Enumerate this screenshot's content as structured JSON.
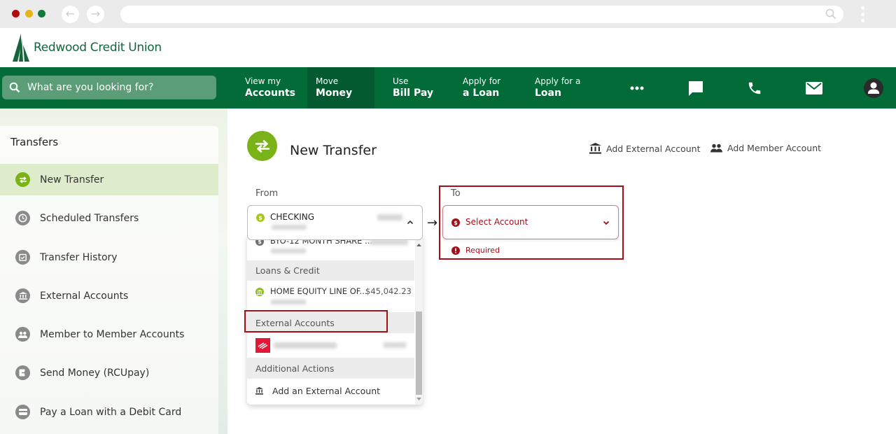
{
  "browser": {
    "back_icon": "arrow-left-icon",
    "forward_icon": "arrow-right-icon",
    "url": ""
  },
  "brand": {
    "name": "Redwood Credit Union",
    "primary_color": "#036b38",
    "accent_color": "#7ab317",
    "error_color": "#a30f17"
  },
  "nav": {
    "search_placeholder": "What are you looking for?",
    "items": [
      {
        "line1": "View my",
        "line2": "Accounts"
      },
      {
        "line1": "Move",
        "line2": "Money",
        "active": true
      },
      {
        "line1": "Use",
        "line2": "Bill Pay"
      },
      {
        "line1": "Apply for",
        "line2": "a Loan"
      },
      {
        "line1": "Apply for a",
        "line2": "Loan"
      }
    ],
    "icons": [
      "more-icon",
      "chat-icon",
      "phone-icon",
      "mail-icon",
      "profile-icon"
    ]
  },
  "sidebar": {
    "title": "Transfers",
    "items": [
      {
        "label": "New Transfer",
        "icon": "transfer-icon",
        "active": true
      },
      {
        "label": "Scheduled Transfers",
        "icon": "clock-icon"
      },
      {
        "label": "Transfer History",
        "icon": "calendar-check-icon"
      },
      {
        "label": "External Accounts",
        "icon": "bank-icon"
      },
      {
        "label": "Member to Member Accounts",
        "icon": "members-icon"
      },
      {
        "label": "Send Money (RCUpay)",
        "icon": "send-money-icon"
      },
      {
        "label": "Pay a Loan with a Debit Card",
        "icon": "card-icon"
      }
    ]
  },
  "main": {
    "title": "New Transfer",
    "add_external_label": "Add External Account",
    "add_member_label": "Add Member Account",
    "from": {
      "label": "From",
      "selected": "CHECKING"
    },
    "to": {
      "label": "To",
      "placeholder": "Select Account",
      "error": "Required"
    },
    "dropdown": {
      "partial_item": "BYO-12 MONTH SHARE ...",
      "groups": [
        {
          "header": "Loans & Credit",
          "items": [
            {
              "name": "HOME EQUITY LINE OF...",
              "balance": "$45,042.23"
            }
          ]
        },
        {
          "header": "External Accounts",
          "items": [
            {
              "name": "",
              "balance": ""
            }
          ]
        },
        {
          "header": "Additional Actions",
          "items": [
            {
              "name": "Add an External Account"
            }
          ]
        }
      ]
    }
  }
}
